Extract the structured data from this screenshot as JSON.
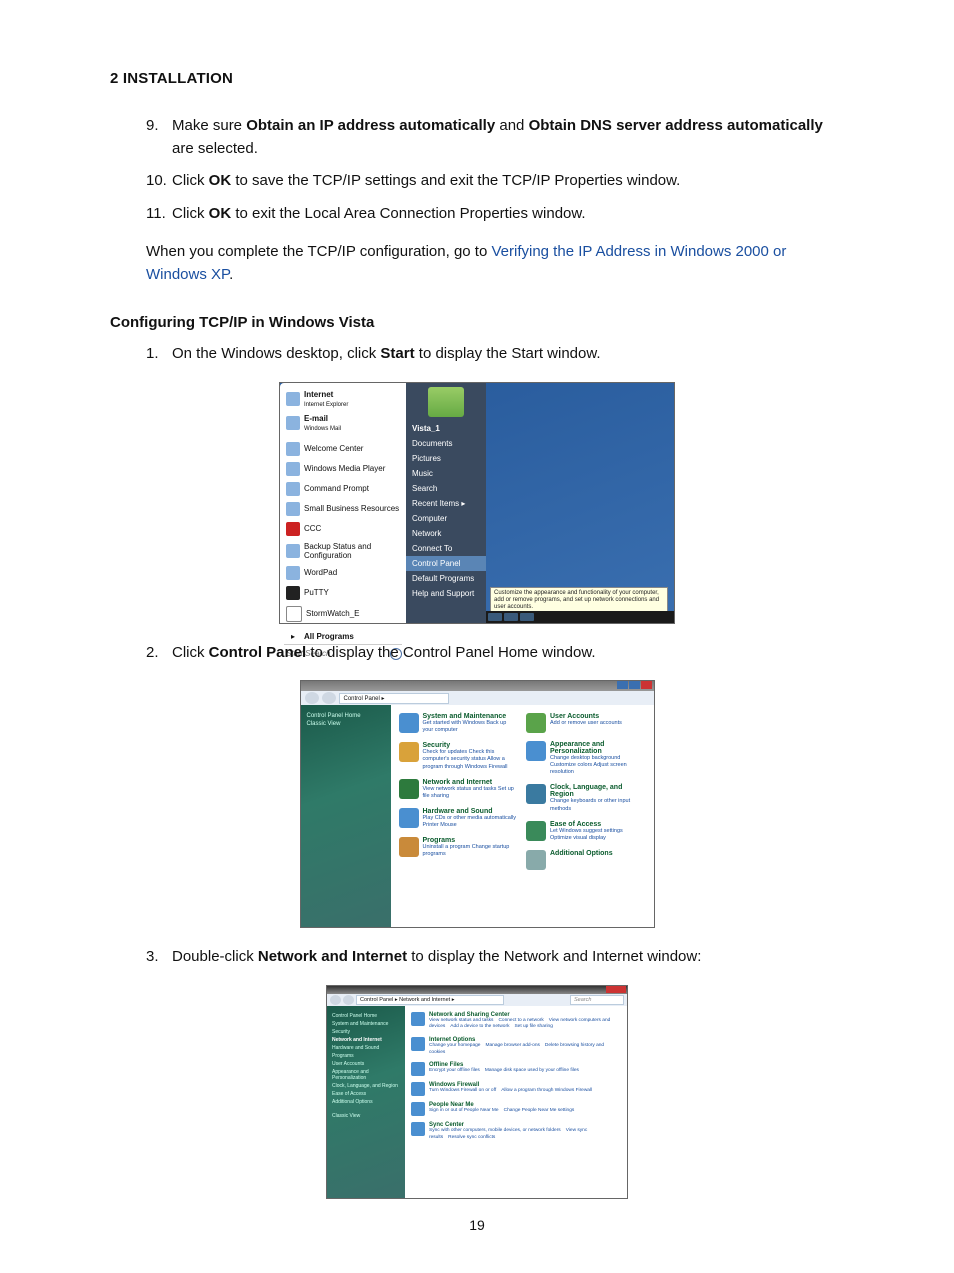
{
  "page_number": "19",
  "section_heading": "2 INSTALLATION",
  "steps_a": {
    "s9": {
      "n": "9.",
      "t1": "Make sure ",
      "b1": "Obtain an IP address automatically",
      "t2": " and ",
      "b2": "Obtain DNS server address automatically",
      "t3": " are selected."
    },
    "s10": {
      "n": "10.",
      "t1": "Click ",
      "b1": "OK",
      "t2": " to save the TCP/IP settings and exit the TCP/IP Properties window."
    },
    "s11": {
      "n": "11.",
      "t1": "Click ",
      "b1": "OK",
      "t2": " to exit the Local Area Connection Properties window."
    }
  },
  "para_complete": {
    "t1": "When you complete the TCP/IP configuration, go to ",
    "link": "Verifying the IP Address in Windows 2000 or Windows XP",
    "t2": "."
  },
  "subheading": "Configuring TCP/IP in Windows Vista",
  "steps_b": {
    "s1": {
      "n": "1.",
      "t1": "On the Windows desktop, click ",
      "b1": "Start",
      "t2": " to display the Start window."
    },
    "s2": {
      "n": "2.",
      "t1": "Click ",
      "b1": "Control Panel",
      "t2": " to display the Control Panel Home window."
    },
    "s3": {
      "n": "3.",
      "t1": "Double-click ",
      "b1": "Network and Internet",
      "t2": " to display the Network and Internet window:"
    }
  },
  "start_menu": {
    "left_pinned": {
      "internet": "Internet",
      "internet_sub": "Internet Explorer",
      "email": "E-mail",
      "email_sub": "Windows Mail"
    },
    "left_items": [
      "Welcome Center",
      "Windows Media Player",
      "Command Prompt",
      "Small Business Resources",
      "CCC",
      "Backup Status and Configuration",
      "WordPad",
      "PuTTY",
      "StormWatch_E"
    ],
    "all_programs": "All Programs",
    "search_placeholder": "Start Search",
    "user": "Vista_1",
    "right_items": [
      "Documents",
      "Pictures",
      "Music",
      "Search",
      "Recent Items",
      "Computer",
      "Network",
      "Connect To",
      "Control Panel",
      "Default Programs",
      "Help and Support"
    ],
    "tooltip": "Customize the appearance and functionality of your computer, add or remove programs, and set up network connections and user accounts."
  },
  "control_panel": {
    "breadcrumb": "Control Panel  ▸",
    "side_links": [
      "Control Panel Home",
      "Classic View"
    ],
    "cats_left": [
      {
        "h": "System and Maintenance",
        "s": "Get started with Windows\nBack up your computer"
      },
      {
        "h": "Security",
        "s": "Check for updates\nCheck this computer's security status\nAllow a program through Windows Firewall"
      },
      {
        "h": "Network and Internet",
        "s": "View network status and tasks\nSet up file sharing"
      },
      {
        "h": "Hardware and Sound",
        "s": "Play CDs or other media automatically\nPrinter\nMouse"
      },
      {
        "h": "Programs",
        "s": "Uninstall a program\nChange startup programs"
      }
    ],
    "cats_right": [
      {
        "h": "User Accounts",
        "s": "Add or remove user accounts"
      },
      {
        "h": "Appearance and Personalization",
        "s": "Change desktop background\nCustomize colors\nAdjust screen resolution"
      },
      {
        "h": "Clock, Language, and Region",
        "s": "Change keyboards or other input methods"
      },
      {
        "h": "Ease of Access",
        "s": "Let Windows suggest settings\nOptimize visual display"
      },
      {
        "h": "Additional Options",
        "s": ""
      }
    ]
  },
  "network_panel": {
    "breadcrumb": "Control Panel  ▸  Network and Internet  ▸",
    "search_placeholder": "Search",
    "side": [
      "Control Panel Home",
      "System and Maintenance",
      "Security",
      "Network and Internet",
      "Hardware and Sound",
      "Programs",
      "User Accounts",
      "Appearance and Personalization",
      "Clock, Language, and Region",
      "Ease of Access",
      "Additional Options",
      "Classic View"
    ],
    "cats": [
      {
        "h": "Network and Sharing Center",
        "links": [
          "View network status and tasks",
          "Connect to a network",
          "View network computers and devices",
          "Add a device to the network",
          "Set up file sharing"
        ]
      },
      {
        "h": "Internet Options",
        "links": [
          "Change your homepage",
          "Manage browser add-ons",
          "Delete browsing history and cookies"
        ]
      },
      {
        "h": "Offline Files",
        "links": [
          "Encrypt your offline files",
          "Manage disk space used by your offline files"
        ]
      },
      {
        "h": "Windows Firewall",
        "links": [
          "Turn Windows Firewall on or off",
          "Allow a program through Windows Firewall"
        ]
      },
      {
        "h": "People Near Me",
        "links": [
          "Sign in or out of People Near Me",
          "Change People Near Me settings"
        ]
      },
      {
        "h": "Sync Center",
        "links": [
          "Sync with other computers, mobile devices, or network folders",
          "View sync results",
          "Resolve sync conflicts"
        ]
      }
    ]
  }
}
